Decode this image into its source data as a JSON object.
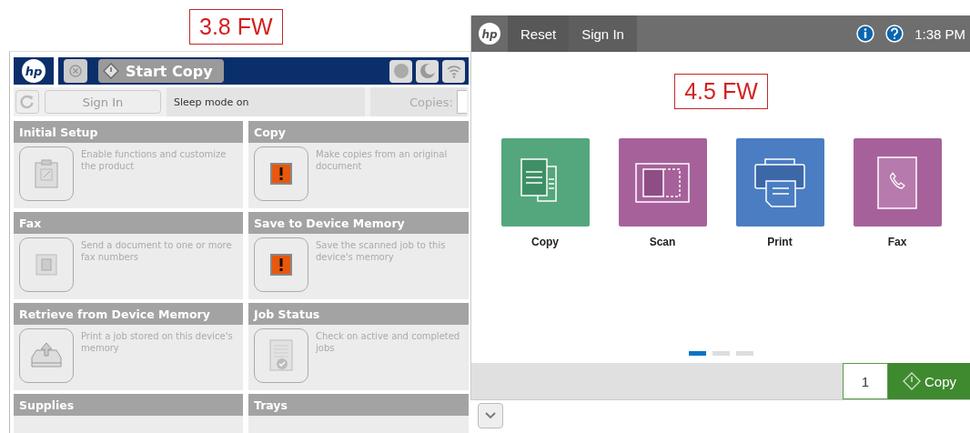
{
  "old_panel": {
    "logo": "hp",
    "version_label": "3.8 FW",
    "start_button": "Start Copy",
    "sign_in": "Sign In",
    "status": "Sleep mode on",
    "copies_label": "Copies:",
    "tiles": [
      {
        "title": "Initial Setup",
        "description": "Enable functions and customize the product",
        "kind": "setup"
      },
      {
        "title": "Copy",
        "description": "Make copies from an original document",
        "kind": "warning"
      },
      {
        "title": "Fax",
        "description": "Send a document to one or more fax numbers",
        "kind": "fax"
      },
      {
        "title": "Save to Device Memory",
        "description": "Save the scanned job to this device's memory",
        "kind": "warning"
      },
      {
        "title": "Retrieve from Device Memory",
        "description": "Print a job stored on this device's memory",
        "kind": "retrieve"
      },
      {
        "title": "Job Status",
        "description": "Check on active and completed jobs",
        "kind": "jobs"
      },
      {
        "title": "Supplies",
        "kind": "none"
      },
      {
        "title": "Trays",
        "kind": "none"
      }
    ]
  },
  "new_panel": {
    "logo": "hp",
    "buttons": [
      "Reset",
      "Sign In"
    ],
    "time": "1:38 PM",
    "version_label": "4.5 FW",
    "apps": [
      {
        "label": "Copy",
        "kind": "copy",
        "color": "#54a67d"
      },
      {
        "label": "Scan",
        "kind": "scan",
        "color": "#a6619b"
      },
      {
        "label": "Print",
        "kind": "print",
        "color": "#4a7dc2"
      },
      {
        "label": "Fax",
        "kind": "fax",
        "color": "#a6619b"
      }
    ],
    "pages": [
      {
        "selected": true
      },
      {
        "selected": false
      },
      {
        "selected": false
      }
    ],
    "copies": "1",
    "start_button": "Copy"
  }
}
